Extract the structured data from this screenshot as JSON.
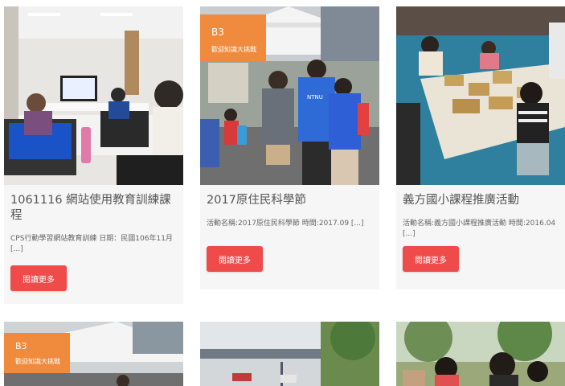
{
  "posts": [
    {
      "title": "1061116 網站使用教育訓練課程",
      "excerpt": "CPS行動學習網站教育訓練 日期：民國106年11月 [...]",
      "button_label": "閱讀更多",
      "image": "classroom-laptops-photo"
    },
    {
      "title": "2017原住民科學節",
      "excerpt": "活動名稱:2017原住民科學節 時間:2017.09 [...]",
      "button_label": "閱讀更多",
      "image": "science-festival-booth-photo",
      "sign": {
        "top": "B3",
        "line": "歡迎知識大挑戰"
      },
      "shirt": "NTNU"
    },
    {
      "title": "義方國小課程推廣活動",
      "excerpt": "活動名稱:義方國小課程推廣活動 時間:2016.04 [...]",
      "button_label": "閱讀更多",
      "image": "students-building-boxes-photo"
    },
    {
      "image": "science-festival-tent-photo",
      "sign": {
        "top": "B3",
        "line": "歡迎知識大挑戰"
      }
    },
    {
      "image": "outdoor-parking-lot-photo"
    },
    {
      "image": "outdoor-students-trees-photo"
    }
  ],
  "colors": {
    "accent": "#ef4b4b",
    "card_bg": "#f6f6f6"
  }
}
